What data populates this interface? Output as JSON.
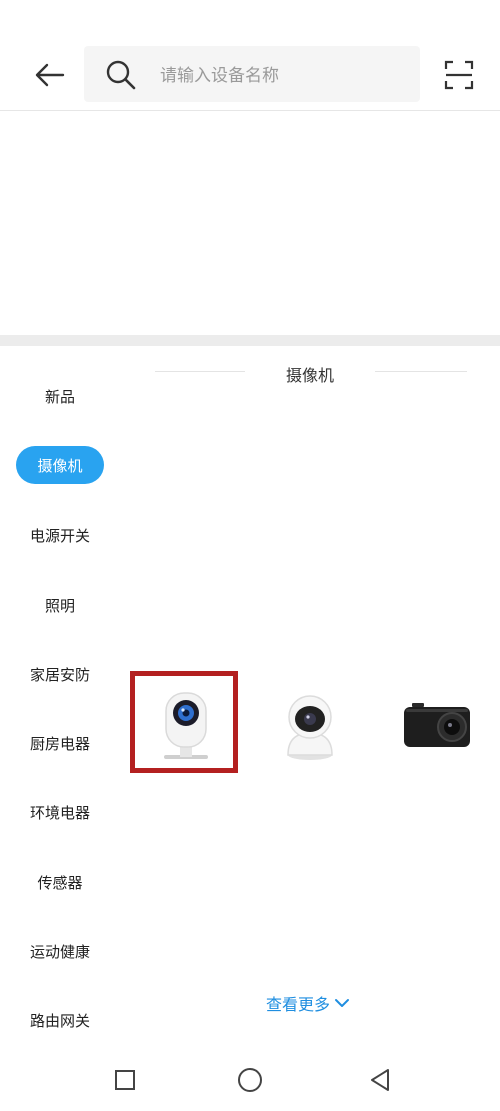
{
  "header": {
    "search": {
      "placeholder": "请输入设备名称",
      "value": ""
    }
  },
  "icons": {
    "back": "back-arrow-icon",
    "search": "search-icon",
    "scan": "scan-icon",
    "more": "chevron-down-icon"
  },
  "sidebar": {
    "items": [
      {
        "label": "新品",
        "selected": false
      },
      {
        "label": "摄像机",
        "selected": true
      },
      {
        "label": "电源开关",
        "selected": false
      },
      {
        "label": "照明",
        "selected": false
      },
      {
        "label": "家居安防",
        "selected": false
      },
      {
        "label": "厨房电器",
        "selected": false
      },
      {
        "label": "环境电器",
        "selected": false
      },
      {
        "label": "传感器",
        "selected": false
      },
      {
        "label": "运动健康",
        "selected": false
      },
      {
        "label": "路由网关",
        "selected": false
      }
    ]
  },
  "main": {
    "section_title": "摄像机",
    "products": [
      {
        "name": "mini-camera-icon",
        "highlighted": true
      },
      {
        "name": "pan-tilt-camera-icon",
        "highlighted": false
      },
      {
        "name": "action-camera-icon",
        "highlighted": false
      }
    ],
    "more_label": "查看更多"
  },
  "colors": {
    "accent": "#29a3f0",
    "link": "#1f8ee0",
    "highlight": "#b42020"
  },
  "navbar": {
    "buttons": [
      "recents-icon",
      "home-icon",
      "back-icon"
    ]
  }
}
